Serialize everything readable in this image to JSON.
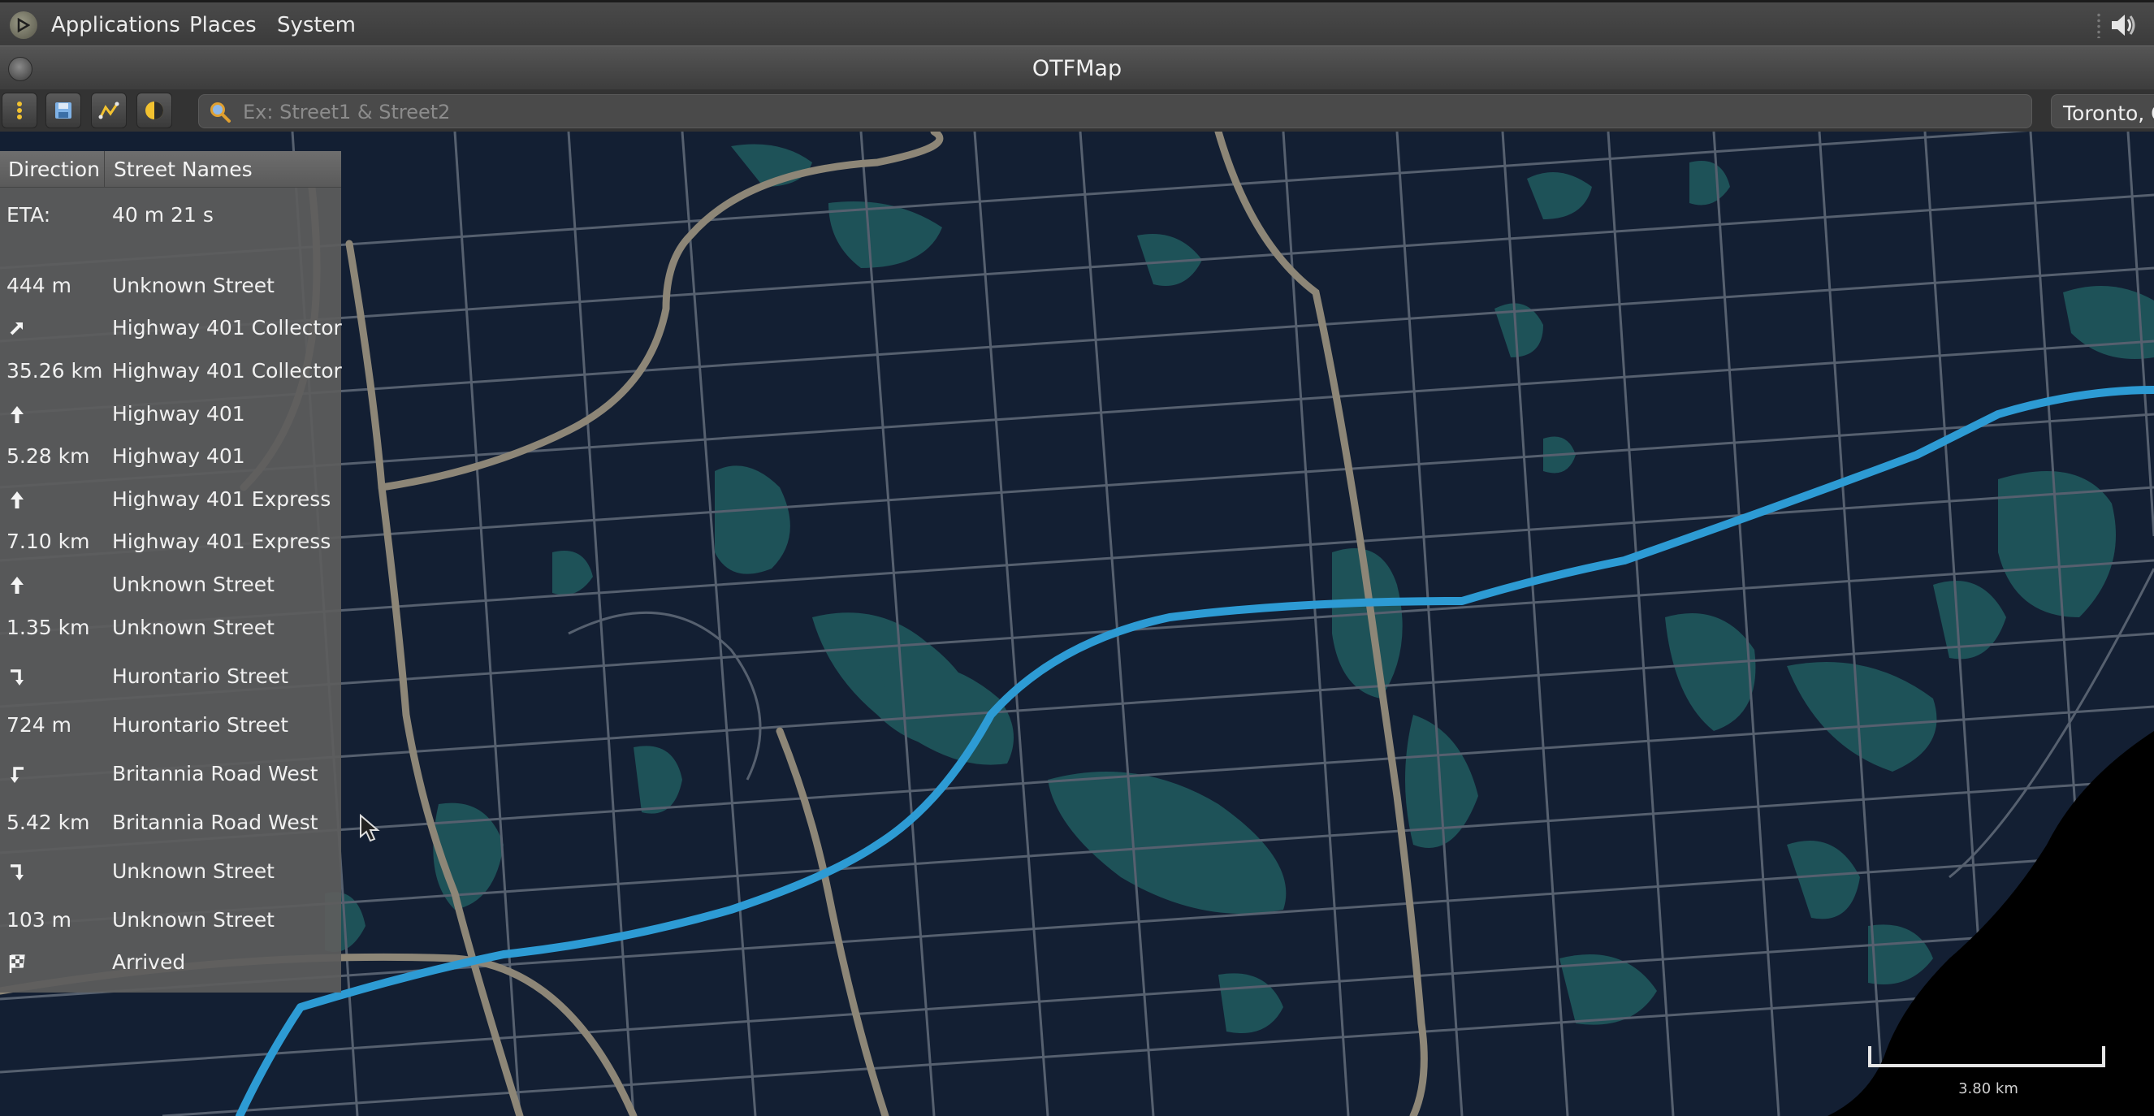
{
  "top_panel": {
    "menus": [
      "Applications",
      "Places",
      "System"
    ]
  },
  "window": {
    "title": "OTFMap"
  },
  "toolbar": {
    "search_placeholder": "Ex: Street1 & Street2",
    "location": "Toronto, O"
  },
  "directions": {
    "headers": {
      "direction": "Direction",
      "street_names": "Street Names"
    },
    "eta_label": "ETA:",
    "eta_value": "40 m 21 s",
    "rows": [
      {
        "direction": "444 m",
        "street": "Unknown Street"
      },
      {
        "icon": "ramp-right-icon",
        "street": "Highway 401 Collector"
      },
      {
        "direction": "35.26 km",
        "street": "Highway 401 Collector"
      },
      {
        "icon": "straight-arrow-icon",
        "street": "Highway 401"
      },
      {
        "direction": "5.28 km",
        "street": "Highway 401"
      },
      {
        "icon": "straight-arrow-icon",
        "street": "Highway 401 Express"
      },
      {
        "direction": "7.10 km",
        "street": "Highway 401 Express"
      },
      {
        "icon": "straight-arrow-icon",
        "street": "Unknown Street"
      },
      {
        "direction": "1.35 km",
        "street": "Unknown Street"
      },
      {
        "icon": "turn-right-icon",
        "street": "Hurontario Street"
      },
      {
        "direction": "724 m",
        "street": "Hurontario Street"
      },
      {
        "icon": "turn-left-icon",
        "street": "Britannia Road West"
      },
      {
        "direction": "5.42 km",
        "street": "Britannia Road West"
      },
      {
        "icon": "turn-right-icon",
        "street": "Unknown Street"
      },
      {
        "direction": "103 m",
        "street": "Unknown Street"
      },
      {
        "icon": "checkered-flag-icon",
        "street": "Arrived"
      }
    ]
  },
  "map": {
    "scale_label": "3.80 km",
    "colors": {
      "background": "#131f33",
      "street": "#56606f",
      "highway": "#8d8677",
      "park": "#1e5258",
      "route": "#2d9bd4",
      "water": "#000000"
    }
  }
}
